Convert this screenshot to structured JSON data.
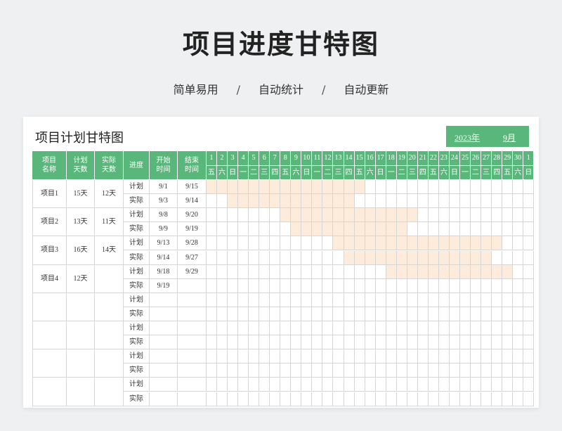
{
  "header": {
    "title": "项目进度甘特图",
    "features": [
      "简单易用",
      "自动统计",
      "自动更新"
    ],
    "separator": "/"
  },
  "sheet": {
    "title": "项目计划甘特图",
    "year": "2023年",
    "month": "9月",
    "colors": {
      "header_green": "#5ab77b",
      "bar": "#fdebdc",
      "grid": "#d6d6d6"
    }
  },
  "table": {
    "columns": [
      "项目\n名称",
      "计划\n天数",
      "实际\n天数",
      "进度",
      "开始\n时间",
      "结束\n时间"
    ],
    "day_numbers": [
      "1",
      "2",
      "3",
      "4",
      "5",
      "6",
      "7",
      "8",
      "9",
      "10",
      "11",
      "12",
      "13",
      "14",
      "15",
      "16",
      "17",
      "18",
      "19",
      "20",
      "21",
      "22",
      "23",
      "24",
      "25",
      "26",
      "27",
      "28",
      "29",
      "30",
      "1"
    ],
    "weekdays": [
      "五",
      "六",
      "日",
      "一",
      "二",
      "三",
      "四",
      "五",
      "六",
      "日",
      "一",
      "二",
      "三",
      "四",
      "五",
      "六",
      "日",
      "一",
      "二",
      "三",
      "四",
      "五",
      "六",
      "日",
      "一",
      "二",
      "三",
      "四",
      "五",
      "六",
      "日"
    ],
    "row_labels": {
      "plan": "计划",
      "actual": "实际"
    },
    "projects": [
      {
        "name": "项目1",
        "plan_days": "15天",
        "actual_days": "12天",
        "plan": {
          "start": "9/1",
          "end": "9/15",
          "from": 1,
          "to": 15
        },
        "actual": {
          "start": "9/3",
          "end": "9/14",
          "from": 3,
          "to": 14
        }
      },
      {
        "name": "项目2",
        "plan_days": "13天",
        "actual_days": "11天",
        "plan": {
          "start": "9/8",
          "end": "9/20",
          "from": 8,
          "to": 20
        },
        "actual": {
          "start": "9/9",
          "end": "9/19",
          "from": 9,
          "to": 19
        }
      },
      {
        "name": "项目3",
        "plan_days": "16天",
        "actual_days": "14天",
        "plan": {
          "start": "9/13",
          "end": "9/28",
          "from": 13,
          "to": 28
        },
        "actual": {
          "start": "9/14",
          "end": "9/27",
          "from": 14,
          "to": 27
        }
      },
      {
        "name": "项目4",
        "plan_days": "12天",
        "actual_days": "",
        "plan": {
          "start": "9/18",
          "end": "9/29",
          "from": 18,
          "to": 29
        },
        "actual": {
          "start": "9/19",
          "end": "",
          "from": null,
          "to": null
        }
      },
      {
        "name": "",
        "plan_days": "",
        "actual_days": "",
        "plan": {
          "start": "",
          "end": "",
          "from": null,
          "to": null
        },
        "actual": {
          "start": "",
          "end": "",
          "from": null,
          "to": null
        }
      },
      {
        "name": "",
        "plan_days": "",
        "actual_days": "",
        "plan": {
          "start": "",
          "end": "",
          "from": null,
          "to": null
        },
        "actual": {
          "start": "",
          "end": "",
          "from": null,
          "to": null
        }
      },
      {
        "name": "",
        "plan_days": "",
        "actual_days": "",
        "plan": {
          "start": "",
          "end": "",
          "from": null,
          "to": null
        },
        "actual": {
          "start": "",
          "end": "",
          "from": null,
          "to": null
        }
      },
      {
        "name": "",
        "plan_days": "",
        "actual_days": "",
        "plan": {
          "start": "",
          "end": "",
          "from": null,
          "to": null
        },
        "actual": {
          "start": "",
          "end": "",
          "from": null,
          "to": null
        }
      }
    ]
  }
}
